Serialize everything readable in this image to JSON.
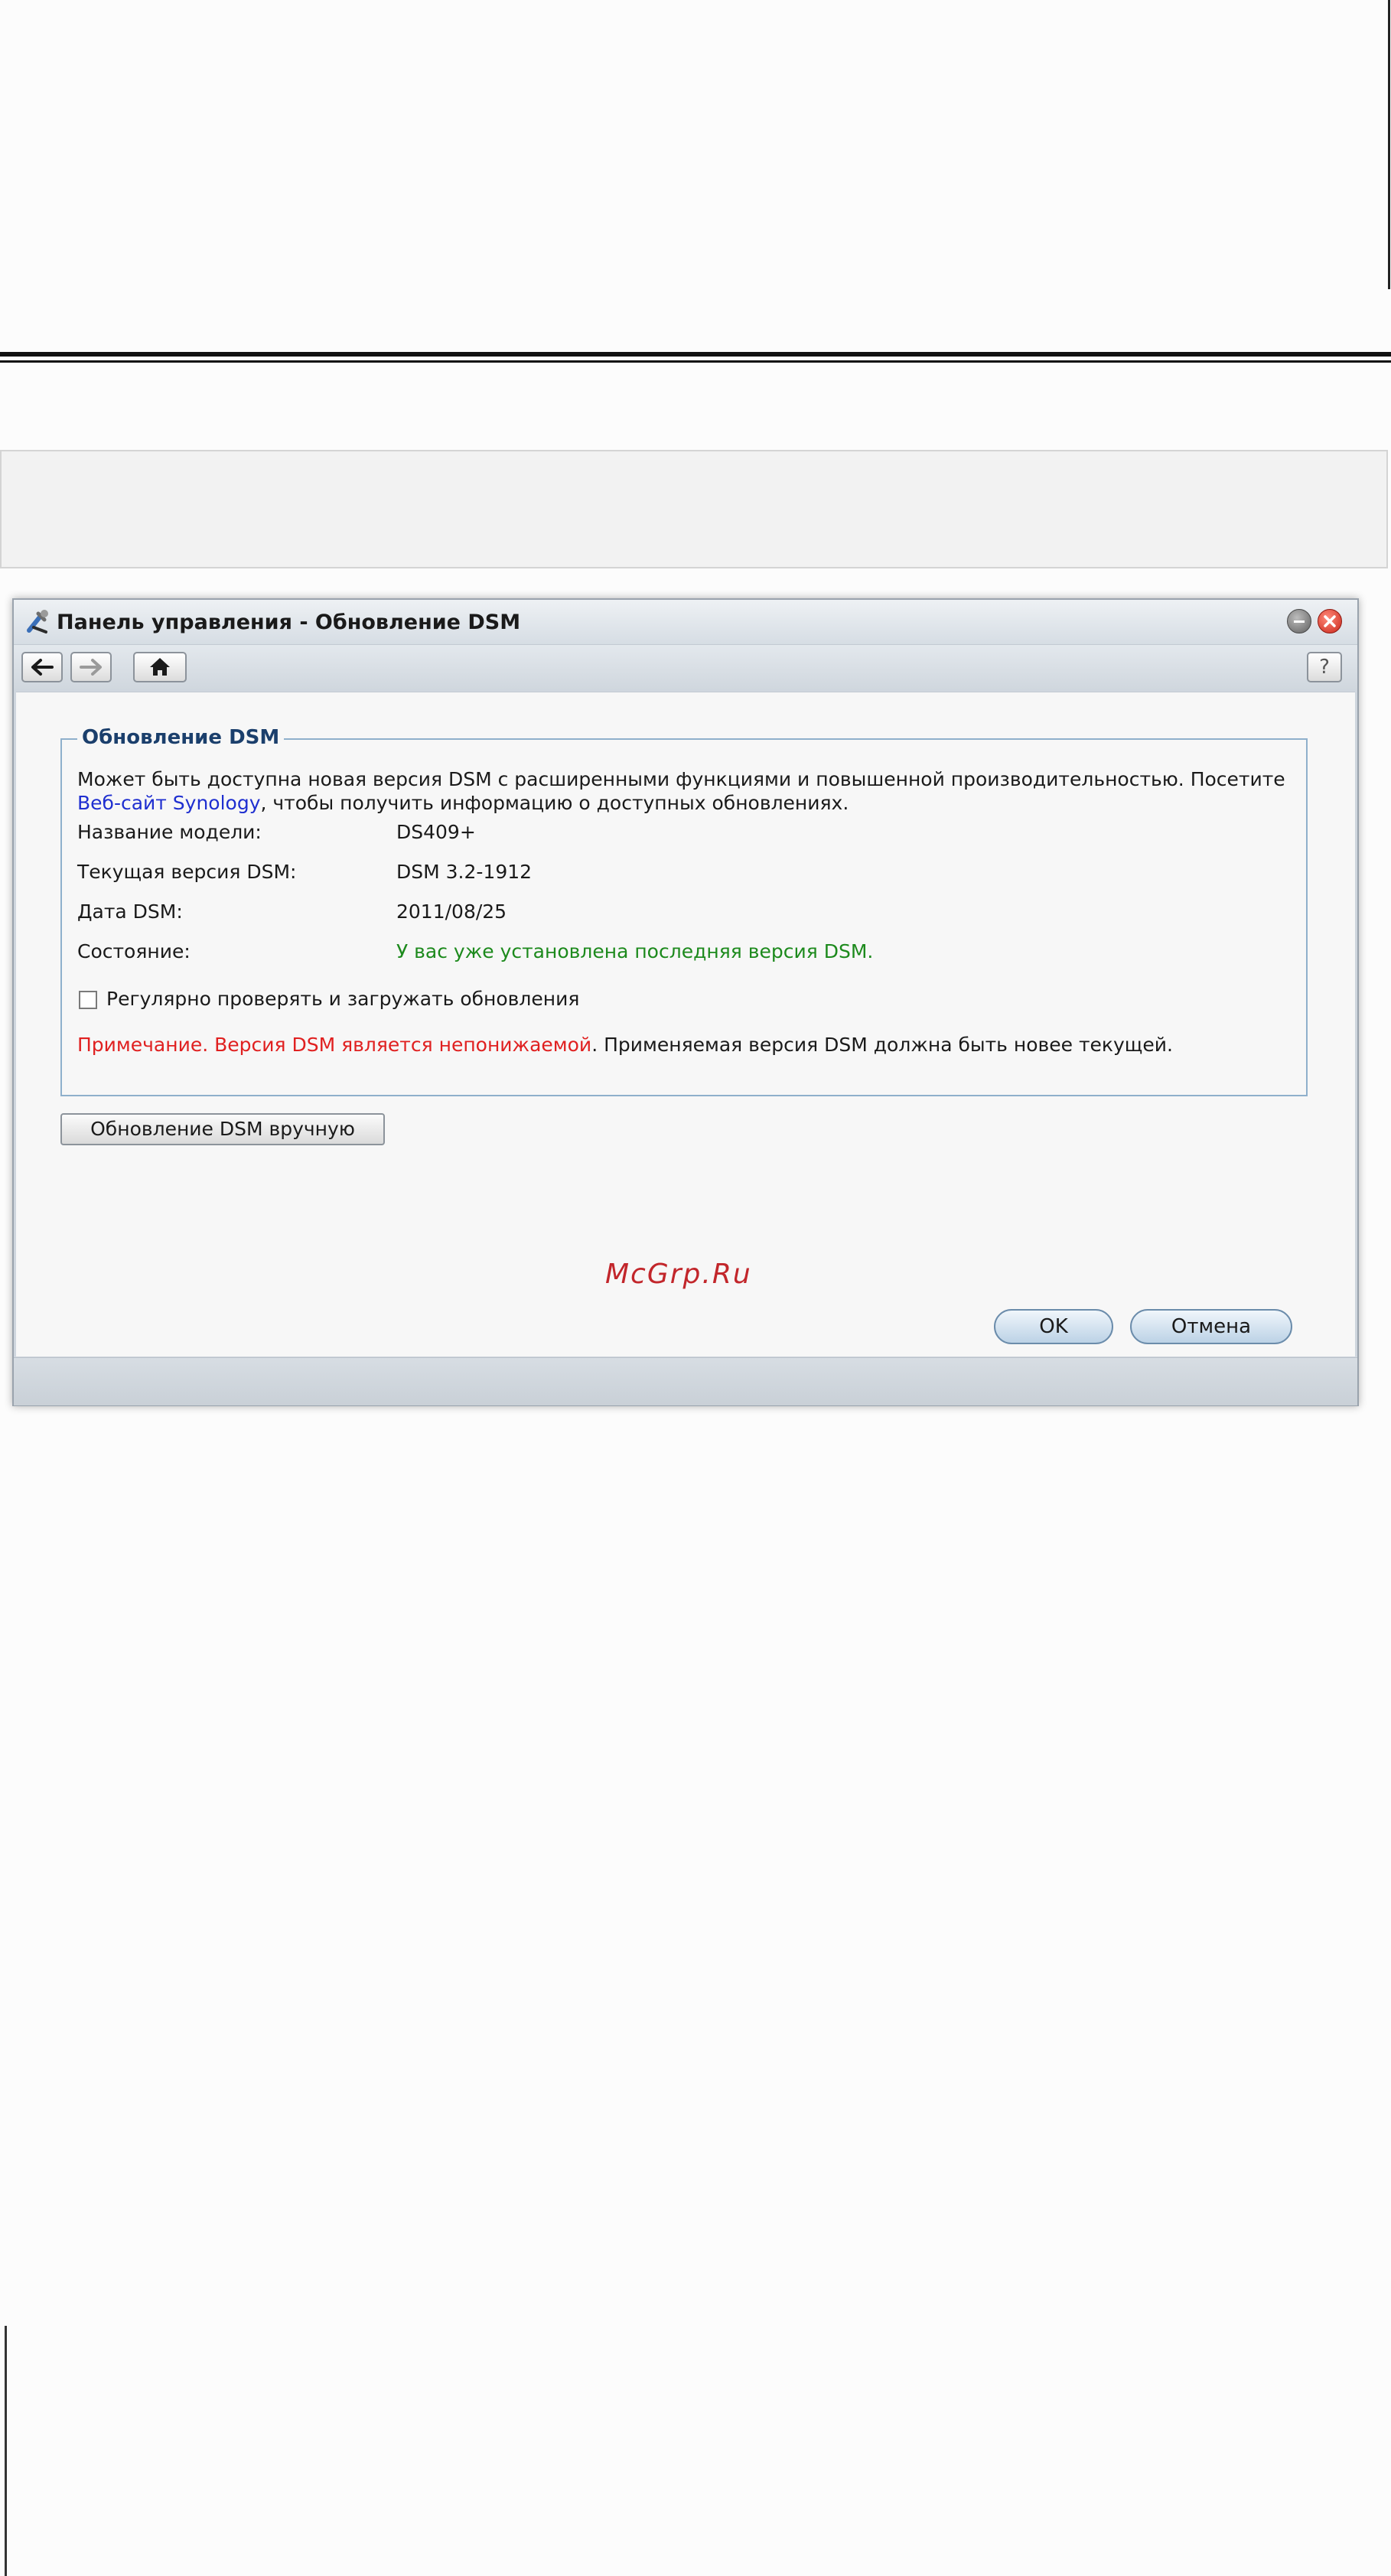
{
  "window": {
    "title": "Панель управления - Обновление DSM"
  },
  "toolbar": {
    "back_icon": "arrow-left-icon",
    "forward_icon": "arrow-right-icon",
    "home_icon": "home-icon",
    "help_label": "?"
  },
  "section": {
    "legend": "Обновление DSM",
    "description_prefix": "Может быть доступна новая версия DSM с расширенными функциями и повышенной производительностью. Посетите ",
    "description_link": "Веб-сайт Synology",
    "description_suffix": ", чтобы получить информацию о доступных обновлениях."
  },
  "info": {
    "model_label": "Название модели:",
    "model_value": "DS409+",
    "version_label": "Текущая версия DSM:",
    "version_value": "DSM 3.2-1912",
    "date_label": "Дата DSM:",
    "date_value": "2011/08/25",
    "status_label": "Состояние:",
    "status_value": "У вас уже установлена последняя версия DSM."
  },
  "auto_update": {
    "label": "Регулярно проверять и загружать обновления",
    "checked": false
  },
  "note": {
    "red_part": "Примечание. Версия DSM является непонижаемой",
    "rest": ". Применяемая версия DSM должна быть новее текущей."
  },
  "buttons": {
    "manual_update": "Обновление DSM вручную",
    "ok": "OK",
    "cancel": "Отмена"
  },
  "watermark": "McGrp.Ru",
  "colors": {
    "link": "#1f2fd0",
    "status_ok": "#1d8a1d",
    "note_red": "#e02020",
    "legend": "#1b3f6c",
    "fieldset_border": "#8fb0cc",
    "watermark": "#c2262b"
  }
}
